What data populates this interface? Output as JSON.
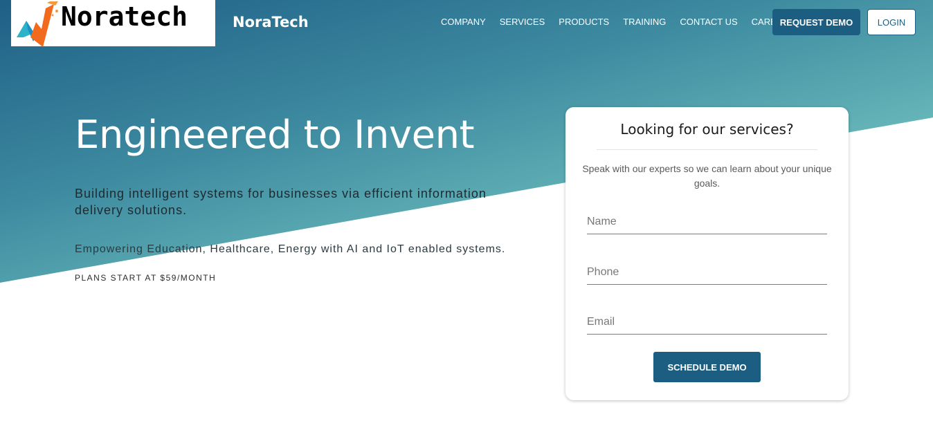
{
  "header": {
    "logo_text": "Noratech",
    "brand_name": "NoraTech",
    "nav": [
      "COMPANY",
      "SERVICES",
      "PRODUCTS",
      "TRAINING",
      "CONTACT US",
      "CAREER"
    ],
    "request_demo_label": "REQUEST DEMO",
    "login_label": "LOGIN"
  },
  "hero": {
    "title": "Engineered to Invent",
    "subtitle": "Building intelligent systems for businesses via efficient information delivery solutions.",
    "description": "Empowering Education, Healthcare, Energy with AI and IoT enabled systems.",
    "plans": "PLANS START AT $59/MONTH"
  },
  "form": {
    "title": "Looking for our services?",
    "description": "Speak with our experts so we can learn about your unique goals.",
    "name_placeholder": "Name",
    "phone_placeholder": "Phone",
    "email_placeholder": "Email",
    "submit_label": "SCHEDULE DEMO"
  },
  "colors": {
    "primary": "#1c5e82",
    "gradient_start": "#1f5f86",
    "gradient_end": "#88d8cc",
    "logo_orange": "#f26a1b"
  },
  "icons": {
    "logo": "noratech-logo-icon"
  }
}
